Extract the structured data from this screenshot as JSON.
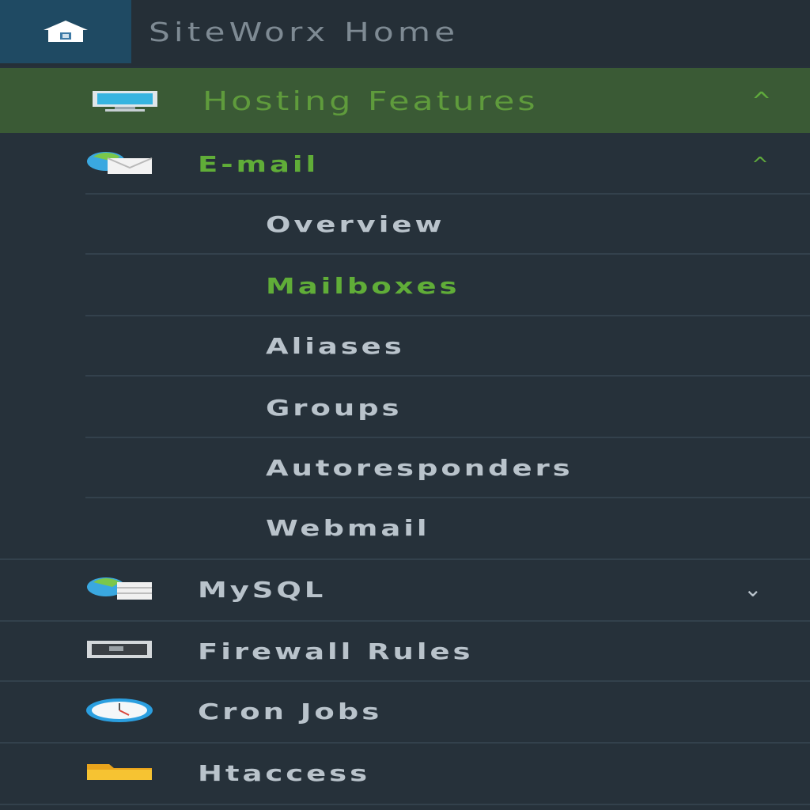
{
  "home": {
    "label": "SiteWorx Home",
    "icon": "home-icon"
  },
  "section": {
    "label": "Hosting Features",
    "icon": "monitor-icon",
    "state": "expanded",
    "caret": "^"
  },
  "email": {
    "label": "E-mail",
    "icon": "email-icon",
    "state": "expanded",
    "caret": "^",
    "items": [
      {
        "label": "Overview"
      },
      {
        "label": "Mailboxes",
        "active": true
      },
      {
        "label": "Aliases"
      },
      {
        "label": "Groups"
      },
      {
        "label": "Autoresponders"
      },
      {
        "label": "Webmail"
      }
    ]
  },
  "features": [
    {
      "label": "MySQL",
      "icon": "database-icon",
      "state": "collapsed",
      "caret": "⌄"
    },
    {
      "label": "Firewall Rules",
      "icon": "firewall-icon"
    },
    {
      "label": "Cron Jobs",
      "icon": "clock-icon"
    },
    {
      "label": "Htaccess",
      "icon": "folder-icon"
    }
  ],
  "colors": {
    "sidebar_bg": "#26313a",
    "section_bg": "#3a5a35",
    "accent_green": "#60ad38",
    "home_icon_bg": "#1f4a63",
    "text": "#b9c3cb"
  }
}
